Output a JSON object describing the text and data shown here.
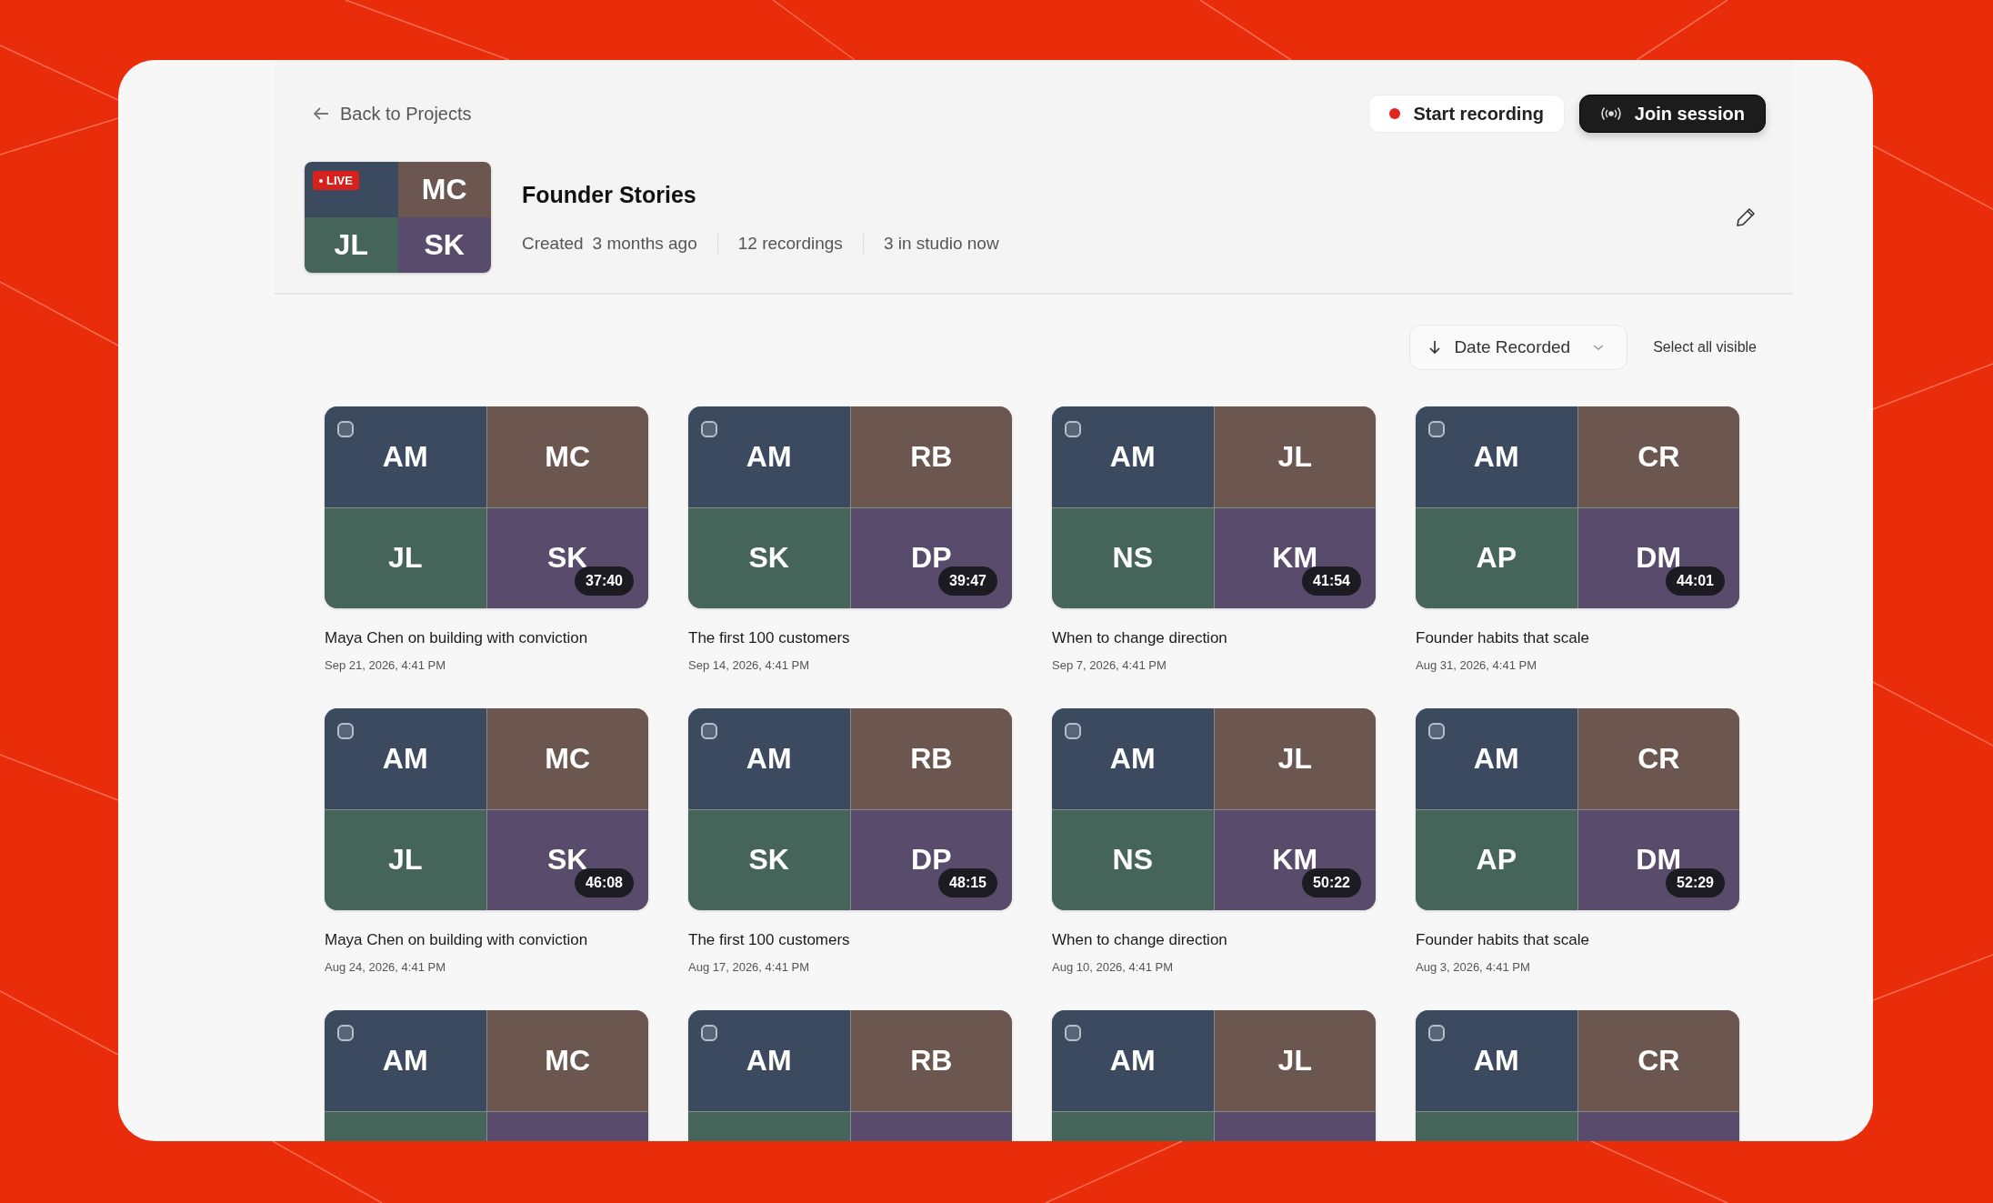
{
  "back_link": {
    "label": "Back to Projects"
  },
  "actions": [
    {
      "kind": "record",
      "label": "Start recording"
    },
    {
      "kind": "join",
      "label": "Join session"
    }
  ],
  "project": {
    "title": "Founder Stories",
    "live_badge": "LIVE",
    "tiles": [
      "MC",
      "JL",
      "SK"
    ],
    "meta": [
      {
        "label": "Created",
        "value": "3 months ago"
      },
      {
        "value": "12 recordings"
      },
      {
        "value": "3 in studio now"
      }
    ]
  },
  "sort": {
    "label": "Date Recorded"
  },
  "select_all": "Select all visible",
  "recordings": [
    {
      "tiles": [
        "AM",
        "MC",
        "JL",
        "SK"
      ],
      "duration": "37:40",
      "title": "Maya Chen on building with conviction",
      "date": "Sep 21, 2026, 4:41 PM",
      "checked": false
    },
    {
      "tiles": [
        "AM",
        "RB",
        "SK",
        "DP"
      ],
      "duration": "39:47",
      "title": "The first 100 customers",
      "date": "Sep 14, 2026, 4:41 PM",
      "checked": false
    },
    {
      "tiles": [
        "AM",
        "JL",
        "NS",
        "KM"
      ],
      "duration": "41:54",
      "title": "When to change direction",
      "date": "Sep 7, 2026, 4:41 PM",
      "checked": false
    },
    {
      "tiles": [
        "AM",
        "CR",
        "AP",
        "DM"
      ],
      "duration": "44:01",
      "title": "Founder habits that scale",
      "date": "Aug 31, 2026, 4:41 PM",
      "checked": false
    },
    {
      "tiles": [
        "AM",
        "MC",
        "JL",
        "SK"
      ],
      "duration": "46:08",
      "title": "Maya Chen on building with conviction",
      "date": "Aug 24, 2026, 4:41 PM",
      "checked": false
    },
    {
      "tiles": [
        "AM",
        "RB",
        "SK",
        "DP"
      ],
      "duration": "48:15",
      "title": "The first 100 customers",
      "date": "Aug 17, 2026, 4:41 PM",
      "checked": false
    },
    {
      "tiles": [
        "AM",
        "JL",
        "NS",
        "KM"
      ],
      "duration": "50:22",
      "title": "When to change direction",
      "date": "Aug 10, 2026, 4:41 PM",
      "checked": false
    },
    {
      "tiles": [
        "AM",
        "CR",
        "AP",
        "DM"
      ],
      "duration": "52:29",
      "title": "Founder habits that scale",
      "date": "Aug 3, 2026, 4:41 PM",
      "checked": false
    },
    {
      "tiles": [
        "AM",
        "MC"
      ],
      "checked": false
    },
    {
      "tiles": [
        "AM",
        "RB"
      ],
      "checked": false
    },
    {
      "tiles": [
        "AM",
        "JL"
      ],
      "checked": false
    },
    {
      "tiles": [
        "AM",
        "CR"
      ],
      "checked": false
    }
  ]
}
